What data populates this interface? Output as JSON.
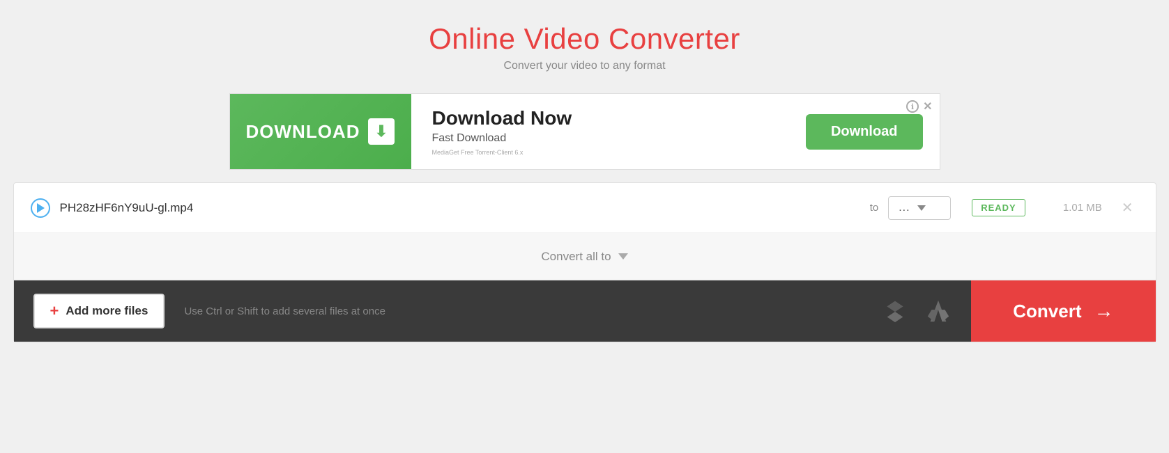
{
  "header": {
    "title": "Online Video Converter",
    "subtitle": "Convert your video to any format"
  },
  "ad": {
    "download_btn_label": "DOWNLOAD",
    "main_text": "Download Now",
    "sub_text": "Fast Download",
    "small_text": "MediaGet\nFree Torrent-Client 6.x",
    "btn_label": "Download",
    "info_icon": "ℹ",
    "close_icon": "✕"
  },
  "file_row": {
    "filename": "PH28zHF6nY9uU-gl.mp4",
    "to_label": "to",
    "format_value": "...",
    "status": "READY",
    "file_size": "1.01 MB"
  },
  "convert_all": {
    "label": "Convert all to"
  },
  "bottom_bar": {
    "add_files_label": "Add more files",
    "hint_text": "Use Ctrl or Shift to add several files at once",
    "convert_label": "Convert"
  }
}
